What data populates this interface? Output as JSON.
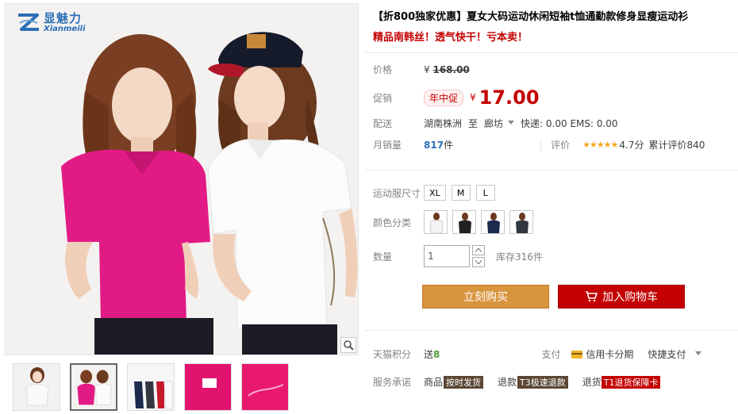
{
  "logo": {
    "cn": "显魅力",
    "en": "Xianmeili"
  },
  "product": {
    "title": "【折800独家优惠】夏女大码运动休闲短袖t恤通勤款修身显瘦运动衫",
    "subtitle": "精品南韩丝！透气快干！亏本卖！"
  },
  "price": {
    "label": "价格",
    "currency": "¥",
    "original": "168.00"
  },
  "promo": {
    "label": "促销",
    "badge": "年中促",
    "currency": "¥",
    "price": "17.00"
  },
  "shipping": {
    "label": "配送",
    "from": "湖南株洲",
    "to_word": "至",
    "dest": "廊坊",
    "fee": "快递: 0.00 EMS: 0.00"
  },
  "sales": {
    "label": "月销量",
    "count": "817",
    "unit": "件",
    "rating_label": "评价",
    "stars": "★★★★★",
    "score": "4.7分",
    "total_reviews": "累计评价840"
  },
  "options": {
    "size_label": "运动服尺寸",
    "sizes": [
      "XL",
      "M",
      "L"
    ],
    "color_label": "颜色分类",
    "colors": [
      "白色",
      "黑色",
      "藏青",
      "灰黑"
    ],
    "color_hex": [
      "#f4f4f4",
      "#222222",
      "#1c2a4e",
      "#333840"
    ]
  },
  "quantity": {
    "label": "数量",
    "value": "1",
    "stock": "库存316件"
  },
  "buttons": {
    "buy_now": "立刻购买",
    "add_cart": "加入购物车"
  },
  "points": {
    "label": "天猫积分",
    "send": "送",
    "value": "8",
    "pay_label": "支付",
    "credit": "信用卡分期",
    "quick_pay": "快捷支付"
  },
  "service": {
    "label": "服务承诺",
    "goods": "商品",
    "goods_tag": "按时发货",
    "refund": "退款",
    "refund_tag": "T3极速退款",
    "return": "退货",
    "return_tag": "T1退货保障卡"
  },
  "colors": {
    "accent": "#c40000",
    "buy_button": "#d9943e",
    "link": "#2b6fb6"
  }
}
